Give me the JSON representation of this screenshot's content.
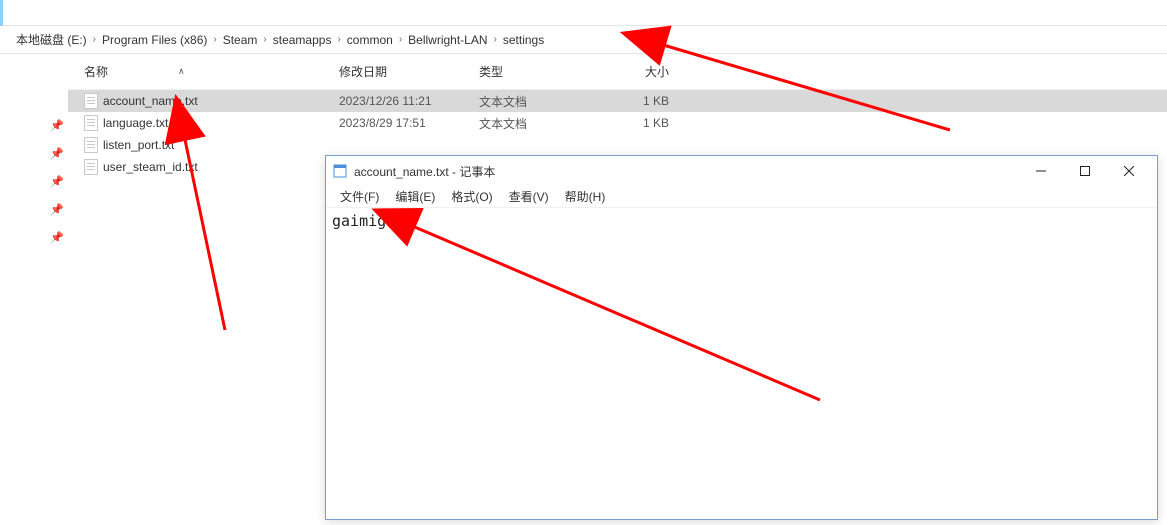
{
  "breadcrumb": [
    "本地磁盘 (E:)",
    "Program Files (x86)",
    "Steam",
    "steamapps",
    "common",
    "Bellwright-LAN",
    "settings"
  ],
  "columns": {
    "name": "名称",
    "date": "修改日期",
    "type": "类型",
    "size": "大小"
  },
  "files": [
    {
      "name": "account_name.txt",
      "date": "2023/12/26 11:21",
      "type": "文本文档",
      "size": "1 KB",
      "selected": true
    },
    {
      "name": "language.txt",
      "date": "2023/8/29 17:51",
      "type": "文本文档",
      "size": "1 KB",
      "selected": false
    },
    {
      "name": "listen_port.txt",
      "date": "",
      "type": "",
      "size": "",
      "selected": false
    },
    {
      "name": "user_steam_id.txt",
      "date": "",
      "type": "",
      "size": "",
      "selected": false
    }
  ],
  "notepad": {
    "title": "account_name.txt - 记事本",
    "menus": [
      "文件(F)",
      "编辑(E)",
      "格式(O)",
      "查看(V)",
      "帮助(H)"
    ],
    "content": "gaimignzi"
  }
}
